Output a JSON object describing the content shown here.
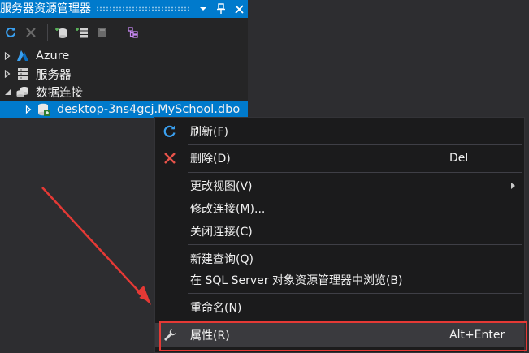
{
  "panel": {
    "title": "服务器资源管理器",
    "title_buttons": [
      "dropdown-icon",
      "pin-icon",
      "close-icon"
    ],
    "toolbar": [
      "refresh-icon",
      "stop-icon",
      "connect-database-icon",
      "connect-server-icon",
      "sharepoint-icon",
      "class-view-icon"
    ]
  },
  "tree": {
    "items": [
      {
        "label": "Azure",
        "icon": "azure-icon",
        "expanded": false
      },
      {
        "label": "服务器",
        "icon": "server-icon",
        "expanded": false
      },
      {
        "label": "数据连接",
        "icon": "data-connections-icon",
        "expanded": true
      },
      {
        "label": "desktop-3ns4gcj.MySchool.dbo",
        "icon": "database-icon",
        "expanded": false,
        "selected": true
      }
    ]
  },
  "menu": {
    "items": [
      {
        "label": "刷新(F)",
        "icon": "refresh-icon",
        "shortcut": ""
      },
      {
        "label": "删除(D)",
        "icon": "delete-icon",
        "shortcut": "Del"
      },
      {
        "label": "更改视图(V)",
        "icon": "",
        "shortcut": "",
        "submenu": true
      },
      {
        "label": "修改连接(M)...",
        "icon": "",
        "shortcut": ""
      },
      {
        "label": "关闭连接(C)",
        "icon": "",
        "shortcut": ""
      },
      {
        "label": "新建查询(Q)",
        "icon": "",
        "shortcut": ""
      },
      {
        "label": "在 SQL Server 对象资源管理器中浏览(B)",
        "icon": "",
        "shortcut": ""
      },
      {
        "label": "重命名(N)",
        "icon": "",
        "shortcut": ""
      },
      {
        "label": "属性(R)",
        "icon": "wrench-icon",
        "shortcut": "Alt+Enter",
        "highlighted": true
      }
    ]
  },
  "colors": {
    "accent": "#007acc",
    "annotation": "#e53935",
    "menu_bg": "#1b1b1c",
    "panel_bg": "#252526"
  }
}
